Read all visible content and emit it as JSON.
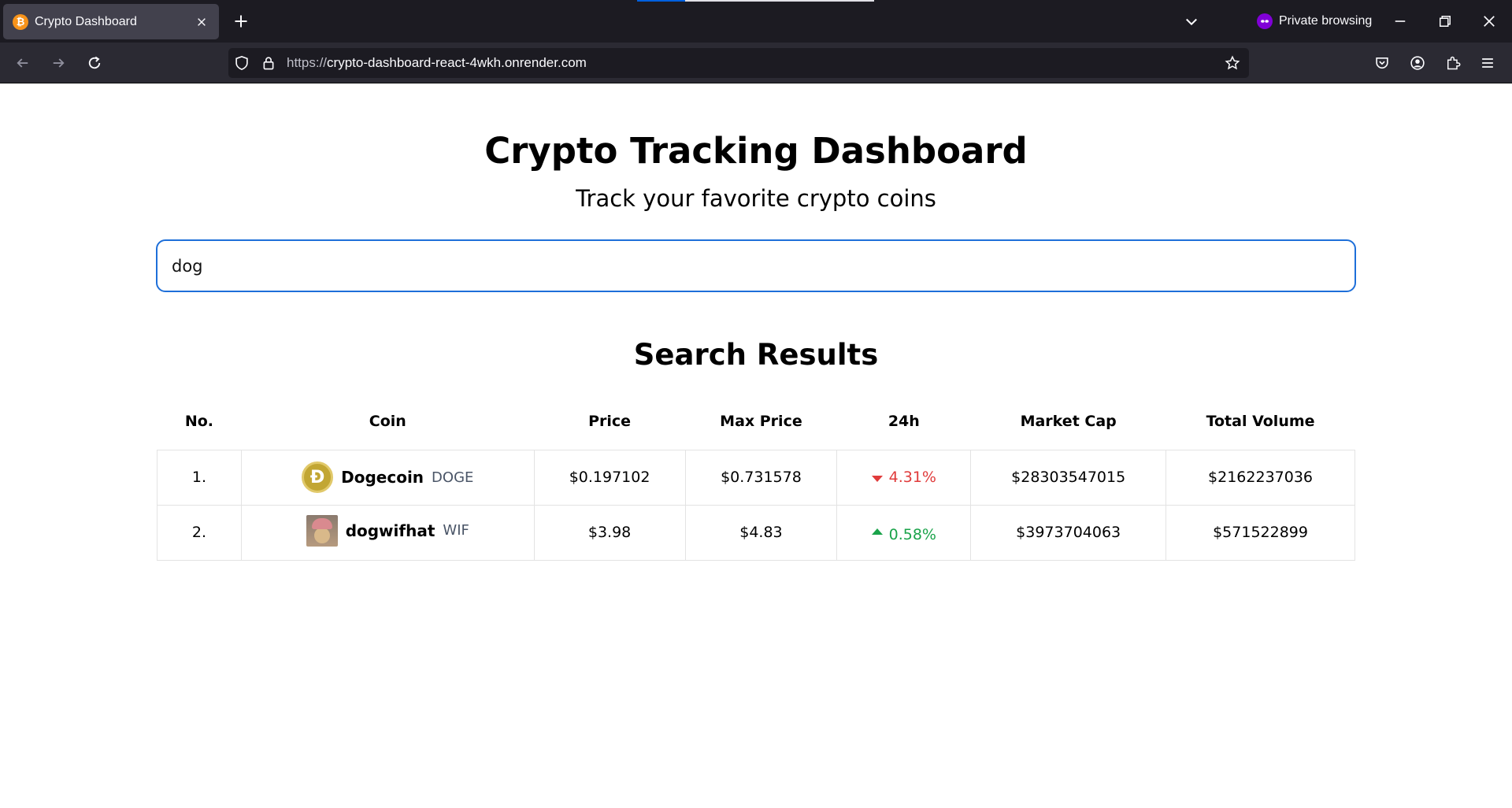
{
  "browser": {
    "tab": {
      "title": "Crypto Dashboard",
      "favicon_glyph": "₿"
    },
    "url": {
      "scheme": "https://",
      "host": "crypto-dashboard-react-4wkh.onrender.com"
    },
    "private_label": "Private browsing"
  },
  "header": {
    "title": "Crypto Tracking Dashboard",
    "subtitle": "Track your favorite crypto coins"
  },
  "search": {
    "value": "dog",
    "placeholder": ""
  },
  "results": {
    "title": "Search Results",
    "columns": [
      "No.",
      "Coin",
      "Price",
      "Max Price",
      "24h",
      "Market Cap",
      "Total Volume"
    ],
    "rows": [
      {
        "no": "1.",
        "name": "Dogecoin",
        "symbol": "DOGE",
        "price": "$0.197102",
        "max_price": "$0.731578",
        "change": "4.31%",
        "direction": "down",
        "market_cap": "$28303547015",
        "total_volume": "$2162237036"
      },
      {
        "no": "2.",
        "name": "dogwifhat",
        "symbol": "WIF",
        "price": "$3.98",
        "max_price": "$4.83",
        "change": "0.58%",
        "direction": "up",
        "market_cap": "$3973704063",
        "total_volume": "$571522899"
      }
    ]
  },
  "colors": {
    "accent_border": "#1e6fd9",
    "negative": "#e03b3b",
    "positive": "#1aa34a",
    "tab_bg": "#42414d",
    "chrome_bg": "#1c1b22"
  }
}
